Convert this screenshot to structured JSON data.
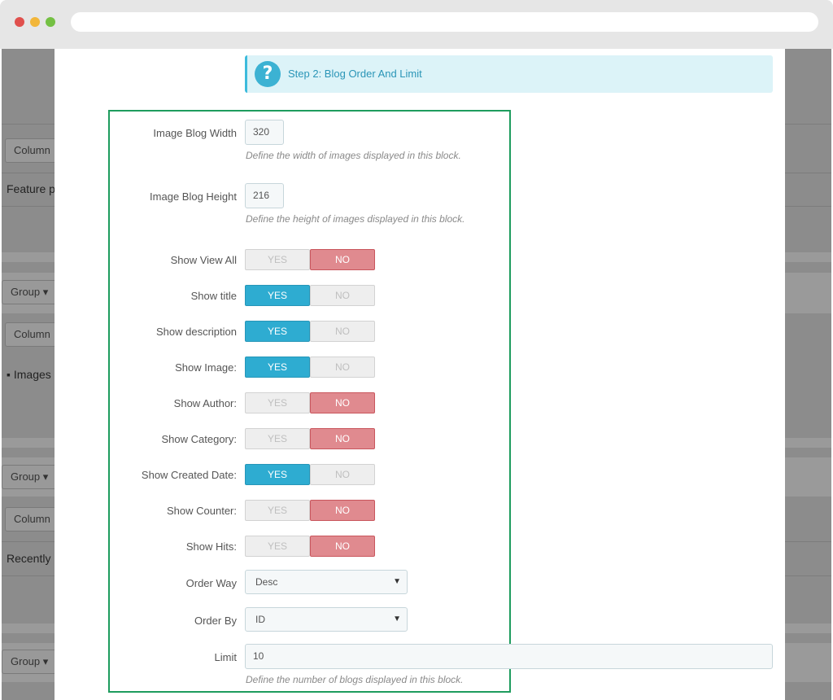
{
  "step": {
    "text": "Step 2: Blog Order And Limit",
    "icon": "question-circle-icon"
  },
  "fields": {
    "image_width": {
      "label": "Image Blog Width",
      "value": "320",
      "help": "Define the width of images displayed in this block."
    },
    "image_height": {
      "label": "Image Blog Height",
      "value": "216",
      "help": "Define the height of images displayed in this block."
    },
    "limit": {
      "label": "Limit",
      "value": "10",
      "help": "Define the number of blogs displayed in this block."
    }
  },
  "switch_labels": {
    "yes": "YES",
    "no": "NO"
  },
  "toggles": [
    {
      "label": "Show View All",
      "value": "NO"
    },
    {
      "label": "Show title",
      "value": "YES"
    },
    {
      "label": "Show description",
      "value": "YES"
    },
    {
      "label": "Show Image:",
      "value": "YES"
    },
    {
      "label": "Show Author:",
      "value": "NO"
    },
    {
      "label": "Show Category:",
      "value": "NO"
    },
    {
      "label": "Show Created Date:",
      "value": "YES"
    },
    {
      "label": "Show Counter:",
      "value": "NO"
    },
    {
      "label": "Show Hits:",
      "value": "NO"
    }
  ],
  "order_way": {
    "label": "Order Way",
    "value": "Desc"
  },
  "order_by": {
    "label": "Order By",
    "value": "ID"
  },
  "background": {
    "column_1": "Column",
    "feature": "Feature p",
    "group_1": "Group",
    "column_2": "Column",
    "images": "Images",
    "group_2": "Group",
    "column_3": "Column",
    "recently": "Recently",
    "group_3": "Group"
  },
  "colors": {
    "yes_active": "#2eacd1",
    "no_active": "#e08a8f",
    "highlight": "#1e9c5e",
    "alert_bg": "#dcf3f8"
  }
}
